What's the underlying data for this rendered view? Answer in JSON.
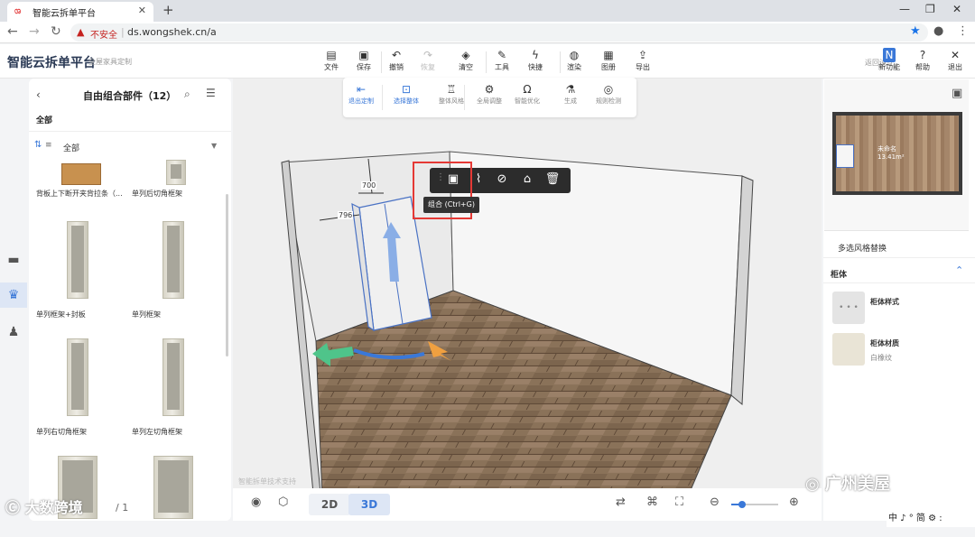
{
  "browser": {
    "tab_title": "智能云拆单平台",
    "favicon": "ශ",
    "not_secure": "不安全",
    "url": "ds.wongshek.cn/a"
  },
  "app": {
    "brand": "智能云拆单平台",
    "brand_sub": "全屋家具定制",
    "toolbar": [
      {
        "label": "文件",
        "icon": "file-icon",
        "glyph": "▤"
      },
      {
        "label": "保存",
        "icon": "save-icon",
        "glyph": "▣"
      },
      {
        "label": "撤销",
        "icon": "undo-icon",
        "glyph": "↶"
      },
      {
        "label": "恢复",
        "icon": "redo-icon",
        "glyph": "↷",
        "disabled": true
      },
      {
        "label": "清空",
        "icon": "eraser-icon",
        "glyph": "◈"
      },
      {
        "label": "工具",
        "icon": "wrench-icon",
        "glyph": "✎"
      },
      {
        "label": "快捷",
        "icon": "bolt-icon",
        "glyph": "ϟ"
      },
      {
        "label": "渲染",
        "icon": "render-icon",
        "glyph": "◍"
      },
      {
        "label": "图册",
        "icon": "album-icon",
        "glyph": "▦"
      },
      {
        "label": "导出",
        "icon": "export-icon",
        "glyph": "⇪"
      }
    ],
    "back_to_design": "返回设计",
    "right_tools": [
      {
        "label": "新功能",
        "icon": "new-feature-icon",
        "glyph": "N"
      },
      {
        "label": "帮助",
        "icon": "help-icon",
        "glyph": "?"
      },
      {
        "label": "退出",
        "icon": "exit-icon",
        "glyph": "✕"
      }
    ]
  },
  "left_panel": {
    "title": "自由组合部件（12）",
    "category_all": "全部",
    "sort_label": "全部",
    "items": [
      {
        "name": "背板上下断开夹背拉条（..."
      },
      {
        "name": "单列后切角框架"
      },
      {
        "name": "单列框架+封板"
      },
      {
        "name": "单列框架"
      },
      {
        "name": "单列右切角框架"
      },
      {
        "name": "单列左切角框架"
      },
      {
        "name": ""
      },
      {
        "name": ""
      }
    ],
    "pager": "/ 1"
  },
  "view_toolbar": [
    {
      "label": "退出定制",
      "icon": "exit-custom-icon",
      "glyph": "⇤",
      "active": true
    },
    {
      "label": "选择整体",
      "icon": "select-all-icon",
      "glyph": "⊡",
      "active": true
    },
    {
      "label": "整体风格",
      "icon": "style-icon",
      "glyph": "♖"
    },
    {
      "label": "全局调整",
      "icon": "global-adjust-icon",
      "glyph": "⚙"
    },
    {
      "label": "智能优化",
      "icon": "smart-opt-icon",
      "glyph": "Ω"
    },
    {
      "label": "生成",
      "icon": "generate-icon",
      "glyph": "⚗"
    },
    {
      "label": "规则检测",
      "icon": "rule-check-icon",
      "glyph": "◎"
    }
  ],
  "canvas": {
    "dim_top": "700",
    "dim_left": "796",
    "tooltip": "组合 (Ctrl+G)",
    "watermark": "智能拆单技术支持"
  },
  "bottom_bar": {
    "mode_2d": "2D",
    "mode_3d": "3D",
    "active_mode": "3D"
  },
  "right_panel": {
    "room_label": "未命名",
    "room_area": "13.41m²",
    "multi_style": "多选风格替换",
    "section": "柜体",
    "props": [
      {
        "label": "柜体样式",
        "value": ""
      },
      {
        "label": "柜体材质",
        "value": "白橡纹"
      }
    ]
  },
  "overlays": {
    "wechat_watermark": "广州美屋",
    "corner_watermark": "大数跨境",
    "ime_bar": "中 ♪ ° 简 ⚙ :"
  },
  "colors": {
    "accent": "#3a78d8",
    "highlight_box": "#e53935",
    "floor": "#8a7259"
  }
}
